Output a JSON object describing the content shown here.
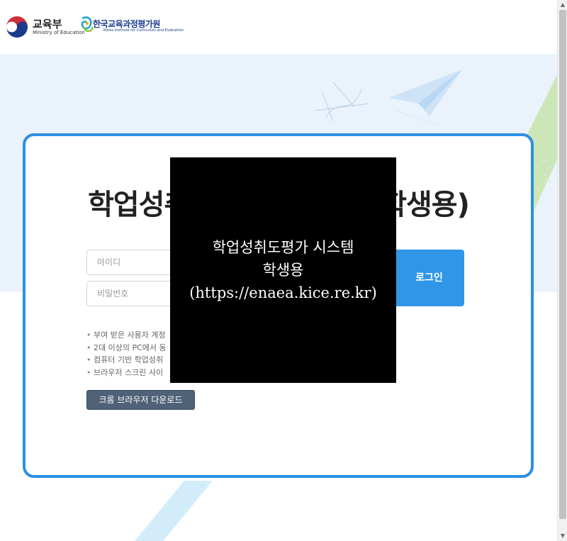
{
  "header": {
    "moe_name": "교육부",
    "moe_name_en": "Ministry of Education",
    "kice_name": "한국교육과정평가원",
    "kice_name_en": "Korea Institute for Curriculum and Evaluation"
  },
  "login": {
    "title_visible_left": "학업성취",
    "title_visible_right": "학생용)",
    "id_placeholder": "아이디",
    "pw_placeholder": "비밀번호",
    "login_label": "로그인",
    "notices": [
      "부여 받은 사용자 계정",
      "2대 이상의 PC에서 동",
      "컴퓨터 기반 학업성취",
      "브라우저 스크린 사이"
    ],
    "chrome_download_label": "크롬 브라우저 다운로드"
  },
  "overlay": {
    "line1": "학업성취도평가 시스템",
    "line2": "학생용",
    "line3": "(https://enaea.kice.re.kr)"
  },
  "colors": {
    "accent": "#2b8fe3",
    "hero_bg": "#eaf3fb",
    "button_dark": "#4f6278"
  },
  "icons": {
    "scroll_up": "▲",
    "scroll_down": "▼"
  }
}
